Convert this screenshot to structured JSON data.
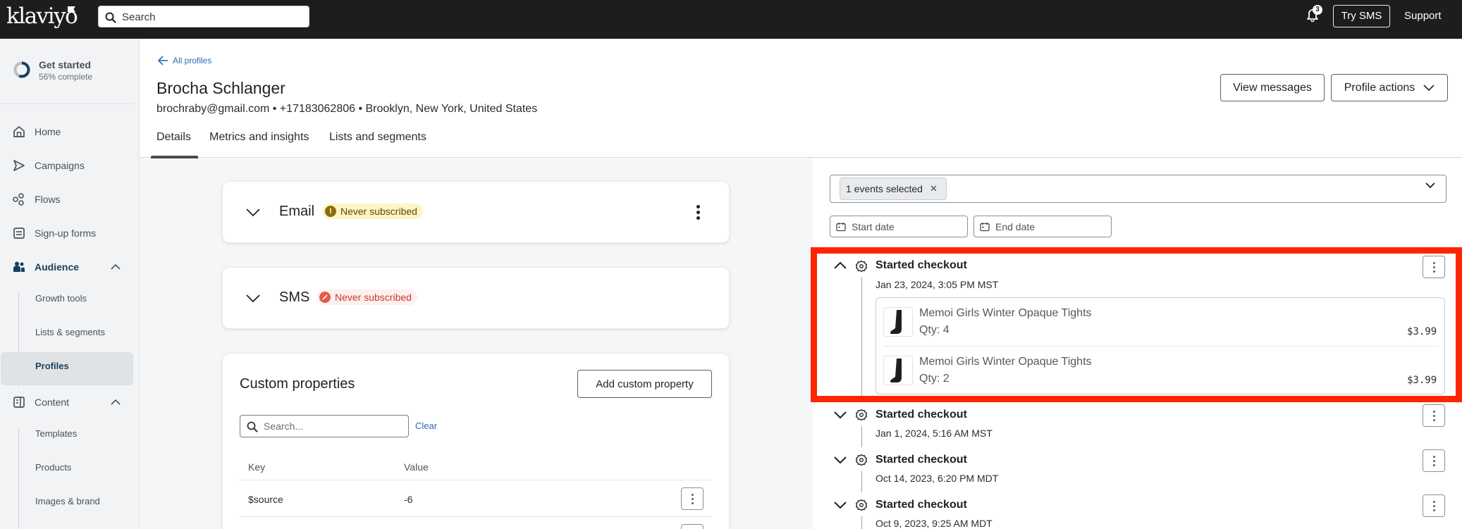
{
  "topbar": {
    "logo": "klaviyo",
    "search_placeholder": "Search",
    "notifications_count": "3",
    "try_sms_label": "Try SMS",
    "support_label": "Support"
  },
  "sidebar": {
    "get_started": {
      "title": "Get started",
      "progress_label": "56% complete",
      "progress_fraction": 0.56
    },
    "items": [
      {
        "label": "Home",
        "icon": "home-icon"
      },
      {
        "label": "Campaigns",
        "icon": "send-icon"
      },
      {
        "label": "Flows",
        "icon": "flows-icon"
      },
      {
        "label": "Sign-up forms",
        "icon": "form-icon"
      },
      {
        "label": "Audience",
        "icon": "users-icon",
        "expanded": true
      },
      {
        "label": "Content",
        "icon": "content-icon",
        "expanded": true
      }
    ],
    "audience_children": [
      "Growth tools",
      "Lists & segments",
      "Profiles"
    ],
    "content_children": [
      "Templates",
      "Products",
      "Images & brand"
    ],
    "active_item": "Profiles"
  },
  "header": {
    "back_link": "All profiles",
    "name": "Brocha Schlanger",
    "meta": "brochraby@gmail.com • +17183062806 • Brooklyn, New York, United States",
    "tabs": [
      "Details",
      "Metrics and insights",
      "Lists and segments"
    ],
    "active_tab": "Details",
    "view_messages_label": "View messages",
    "profile_actions_label": "Profile actions"
  },
  "consent": {
    "email": {
      "title": "Email",
      "status": "Never subscribed"
    },
    "sms": {
      "title": "SMS",
      "status": "Never subscribed"
    }
  },
  "custom_properties": {
    "title": "Custom properties",
    "add_label": "Add custom property",
    "search_placeholder": "Search...",
    "clear_label": "Clear",
    "columns": [
      "Key",
      "Value"
    ],
    "rows": [
      {
        "key": "$source",
        "value": "-6"
      }
    ]
  },
  "activity": {
    "events_chip": "1 events selected",
    "start_date_placeholder": "Start date",
    "end_date_placeholder": "End date",
    "events": [
      {
        "title": "Started checkout",
        "time": "Jan 23, 2024, 3:05 PM MST",
        "expanded": true,
        "items": [
          {
            "name": "Memoi Girls Winter Opaque Tights",
            "qty": "Qty: 4",
            "price": "$3.99"
          },
          {
            "name": "Memoi Girls Winter Opaque Tights",
            "qty": "Qty: 2",
            "price": "$3.99"
          }
        ]
      },
      {
        "title": "Started checkout",
        "time": "Jan 1, 2024, 5:16 AM MST",
        "expanded": false
      },
      {
        "title": "Started checkout",
        "time": "Oct 14, 2023, 6:20 PM MDT",
        "expanded": false
      },
      {
        "title": "Started checkout",
        "time": "Oct 9, 2023, 9:25 AM MDT",
        "expanded": false
      }
    ]
  },
  "colors": {
    "highlight": "#ff2400",
    "link": "#2b6cb0",
    "warn_badge_bg": "#fdf5c3",
    "error_badge_text": "#c43a2d"
  }
}
